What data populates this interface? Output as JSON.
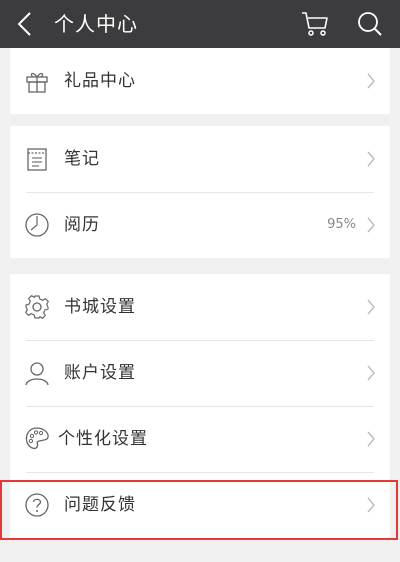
{
  "header": {
    "title": "个人中心",
    "icons": [
      "back-icon",
      "cart-icon",
      "search-icon"
    ]
  },
  "sections": [
    {
      "items": [
        {
          "label": "礼品中心",
          "icon": "gift-icon"
        }
      ]
    },
    {
      "items": [
        {
          "label": "笔记",
          "icon": "notepad-icon"
        },
        {
          "label": "阅历",
          "icon": "clock-icon",
          "value": "95%"
        }
      ]
    },
    {
      "items": [
        {
          "label": "书城设置",
          "icon": "gear-icon"
        },
        {
          "label": "账户设置",
          "icon": "user-icon"
        },
        {
          "label": "个性化设置",
          "icon": "palette-icon"
        },
        {
          "label": "问题反馈",
          "icon": "question-icon"
        }
      ]
    }
  ],
  "colors": {
    "header_bg": "#3c3c3e",
    "page_bg": "#f0f0f0",
    "highlight": "#e53935"
  }
}
